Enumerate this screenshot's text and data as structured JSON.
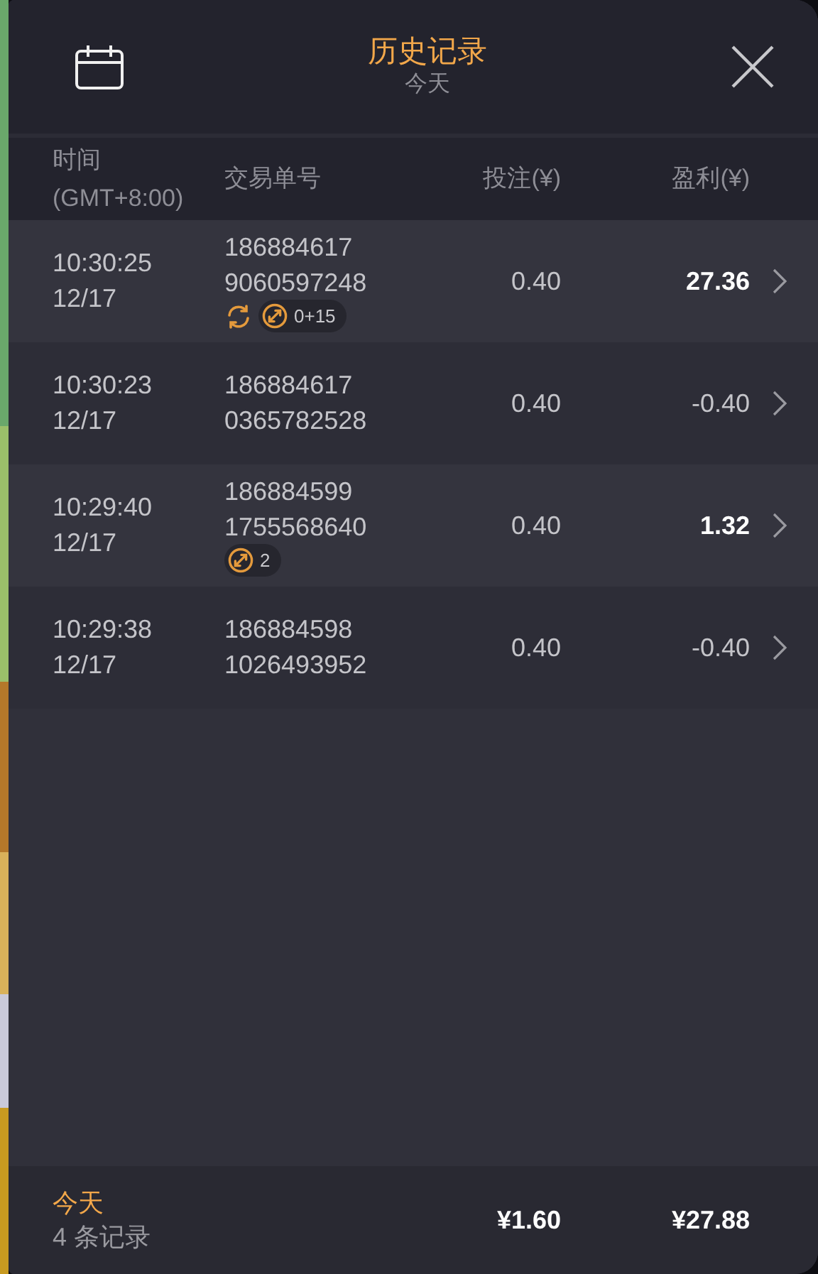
{
  "header": {
    "title": "历史记录",
    "subtitle": "今天"
  },
  "table": {
    "columns": [
      {
        "label": "时间",
        "sublabel": "(GMT+8:00)"
      },
      {
        "label": "交易单号"
      },
      {
        "label": "投注(¥)"
      },
      {
        "label": "盈利(¥)"
      }
    ],
    "rows": [
      {
        "time": "10:30:25",
        "date": "12/17",
        "order_a": "186884617",
        "order_b": "9060597248",
        "stake": "0.40",
        "profit": "27.36",
        "win": true,
        "tags": [
          {
            "kind": "refresh"
          },
          {
            "kind": "bonus",
            "text": "0+15"
          }
        ]
      },
      {
        "time": "10:30:23",
        "date": "12/17",
        "order_a": "186884617",
        "order_b": "0365782528",
        "stake": "0.40",
        "profit": "-0.40",
        "win": false,
        "tags": []
      },
      {
        "time": "10:29:40",
        "date": "12/17",
        "order_a": "186884599",
        "order_b": "1755568640",
        "stake": "0.40",
        "profit": "1.32",
        "win": true,
        "tags": [
          {
            "kind": "bonus",
            "text": "2"
          }
        ]
      },
      {
        "time": "10:29:38",
        "date": "12/17",
        "order_a": "186884598",
        "order_b": "1026493952",
        "stake": "0.40",
        "profit": "-0.40",
        "win": false,
        "tags": []
      }
    ]
  },
  "footer": {
    "period": "今天",
    "count": "4 条记录",
    "stake_total": "¥1.60",
    "profit_total": "¥27.88"
  }
}
